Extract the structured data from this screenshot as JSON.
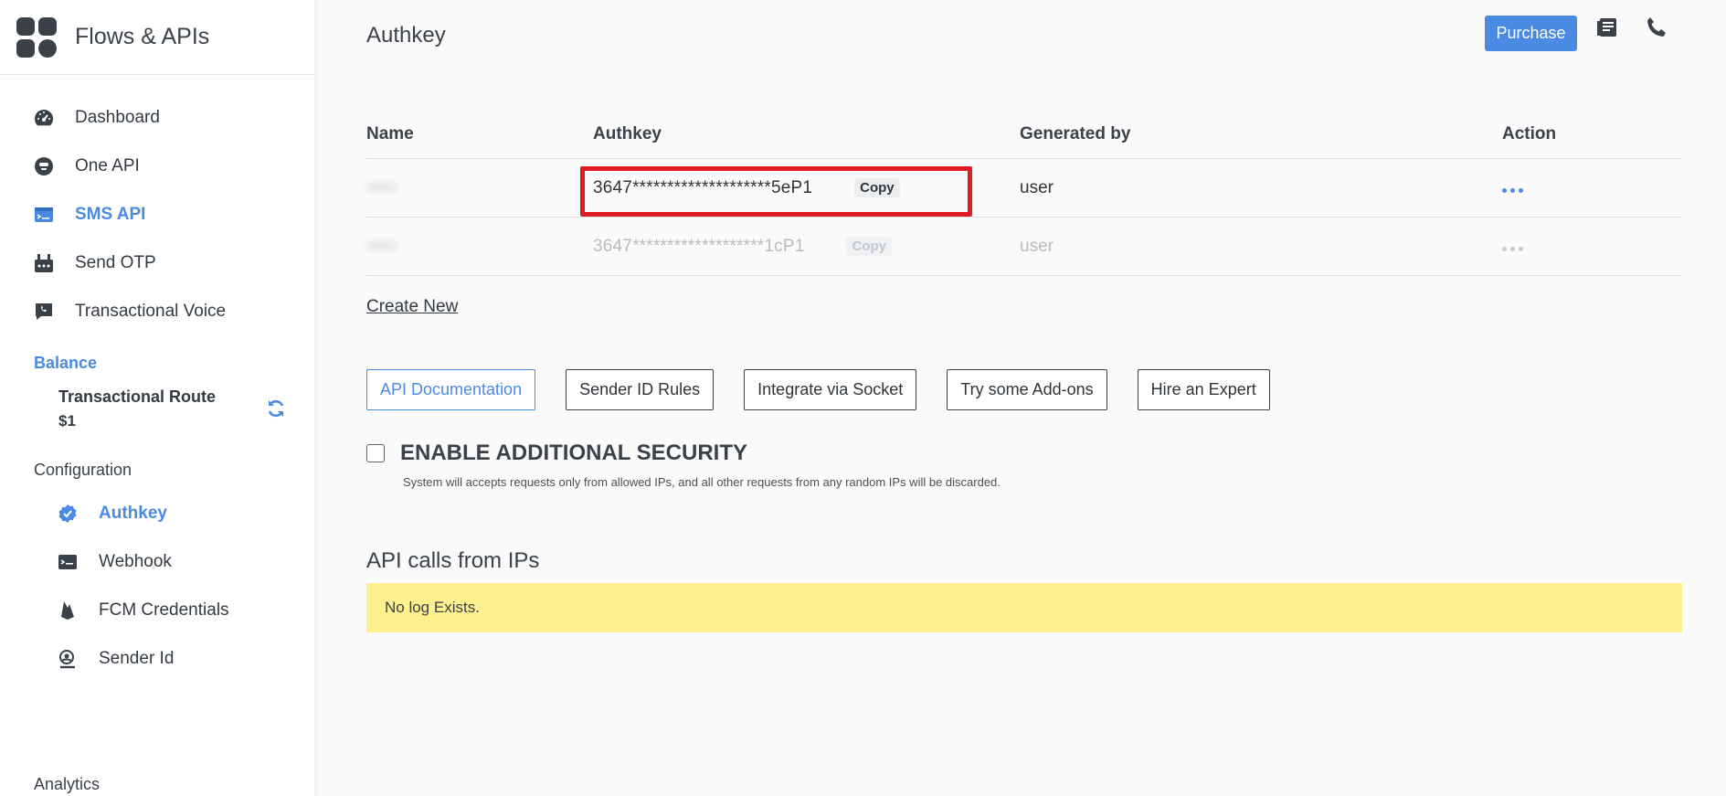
{
  "brand": {
    "title": "Flows & APIs"
  },
  "sidebar": {
    "items": [
      {
        "label": "Dashboard",
        "icon": "speedometer-icon"
      },
      {
        "label": "One API",
        "icon": "robot-icon"
      },
      {
        "label": "SMS API",
        "icon": "terminal-card-icon",
        "active": true
      },
      {
        "label": "Send OTP",
        "icon": "otp-icon"
      },
      {
        "label": "Transactional Voice",
        "icon": "voice-chat-icon"
      }
    ],
    "balance": {
      "title": "Balance",
      "route_label": "Transactional Route",
      "amount": "$1"
    },
    "configuration": {
      "title": "Configuration",
      "items": [
        {
          "label": "Authkey",
          "icon": "verified-badge-icon",
          "active": true
        },
        {
          "label": "Webhook",
          "icon": "terminal-window-icon"
        },
        {
          "label": "FCM Credentials",
          "icon": "firebase-icon"
        },
        {
          "label": "Sender Id",
          "icon": "user-search-icon"
        }
      ]
    },
    "analytics_title": "Analytics"
  },
  "header": {
    "title": "Authkey",
    "purchase_label": "Purchase"
  },
  "table": {
    "columns": [
      "Name",
      "Authkey",
      "Generated by",
      "Action"
    ],
    "rows": [
      {
        "authkey": "3647********************5eP1",
        "copy_label": "Copy",
        "generated_by": "user"
      },
      {
        "authkey": "3647*******************1cP1",
        "copy_label": "Copy",
        "generated_by": "user"
      }
    ]
  },
  "create_new_label": "Create New",
  "buttons": [
    "API Documentation",
    "Sender ID Rules",
    "Integrate via Socket",
    "Try some Add-ons",
    "Hire an Expert"
  ],
  "security": {
    "label": "ENABLE ADDITIONAL SECURITY",
    "note": "System will accepts requests only from allowed IPs, and all other requests from any random IPs will be discarded."
  },
  "api_calls": {
    "title": "API calls from IPs",
    "empty_message": "No log Exists."
  },
  "colors": {
    "accent": "#4a8ae3",
    "highlight": "#e01b24",
    "log_bg": "#fff08f",
    "text": "#3a4149"
  }
}
